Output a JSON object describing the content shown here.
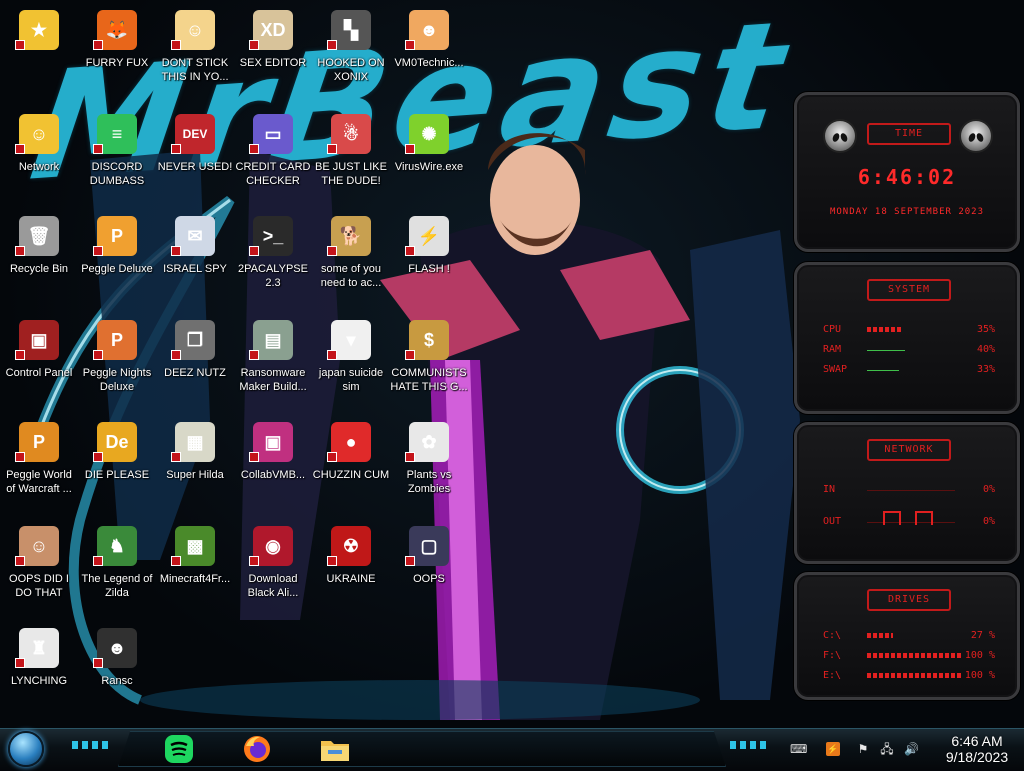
{
  "desktop": {
    "wallpaper_text": "MrBeast",
    "icons": [
      {
        "label": "",
        "color": "#f1c232",
        "glyph": "★"
      },
      {
        "label": "FURRY FUX",
        "color": "#e8661a",
        "glyph": "🦊"
      },
      {
        "label": "DONT STICK THIS IN YO...",
        "color": "#f4d48c",
        "glyph": "☺"
      },
      {
        "label": "SEX EDITOR",
        "color": "#d8c39a",
        "glyph": "XD"
      },
      {
        "label": "HOOKED ON XONIX",
        "color": "#555555",
        "glyph": "▚"
      },
      {
        "label": "VM0Technic...",
        "color": "#f0a860",
        "glyph": "☻"
      },
      {
        "label": "Network",
        "color": "#f1c232",
        "glyph": "☺"
      },
      {
        "label": "DISCORD DUMBASS",
        "color": "#2fbf5a",
        "glyph": "≡"
      },
      {
        "label": "NEVER USED!",
        "color": "#c0262c",
        "glyph": "DEV"
      },
      {
        "label": "CREDIT CARD CHECKER",
        "color": "#6a5acd",
        "glyph": "▭"
      },
      {
        "label": "BE JUST LIKE THE DUDE!",
        "color": "#d94a4a",
        "glyph": "☃"
      },
      {
        "label": "VirusWire.exe",
        "color": "#7fd12c",
        "glyph": "✺"
      },
      {
        "label": "Recycle Bin",
        "color": "#9a9a9a",
        "glyph": "🗑"
      },
      {
        "label": "Peggle Deluxe",
        "color": "#f0a030",
        "glyph": "P"
      },
      {
        "label": "ISRAEL SPY",
        "color": "#cfd8e6",
        "glyph": "✉"
      },
      {
        "label": "2PACALYPSE 2.3",
        "color": "#2a2a2a",
        "glyph": ">_"
      },
      {
        "label": "some of you need to ac...",
        "color": "#c8a050",
        "glyph": "🐕"
      },
      {
        "label": "FLASH !",
        "color": "#e0e0e0",
        "glyph": "⚡"
      },
      {
        "label": "Control Panel",
        "color": "#a02020",
        "glyph": "▣"
      },
      {
        "label": "Peggle Nights Deluxe",
        "color": "#e07030",
        "glyph": "P"
      },
      {
        "label": "DEEZ NUTZ",
        "color": "#707070",
        "glyph": "❐"
      },
      {
        "label": "Ransomware Maker Build...",
        "color": "#8aa090",
        "glyph": "▤"
      },
      {
        "label": "japan suicide sim",
        "color": "#f0f0f0",
        "glyph": "▾"
      },
      {
        "label": "COMMUNISTS HATE THIS G...",
        "color": "#c89a40",
        "glyph": "$"
      },
      {
        "label": "Peggle World of Warcraft ...",
        "color": "#e08a20",
        "glyph": "P"
      },
      {
        "label": "DIE PLEASE",
        "color": "#e8a820",
        "glyph": "De"
      },
      {
        "label": "Super Hilda",
        "color": "#d8d8c8",
        "glyph": "▦"
      },
      {
        "label": "CollabVMB...",
        "color": "#c03080",
        "glyph": "▣"
      },
      {
        "label": "CHUZZIN CUM",
        "color": "#e02a2a",
        "glyph": "●"
      },
      {
        "label": "Plants vs Zombies",
        "color": "#e8e8e8",
        "glyph": "✿"
      },
      {
        "label": "OOPS DID I DO THAT",
        "color": "#c8906a",
        "glyph": "☺"
      },
      {
        "label": "The Legend of Zilda",
        "color": "#3a8a3a",
        "glyph": "♞"
      },
      {
        "label": "Minecraft4Fr...",
        "color": "#4a8a2a",
        "glyph": "▩"
      },
      {
        "label": "Download Black Ali...",
        "color": "#b0182c",
        "glyph": "◉"
      },
      {
        "label": "UKRAINE",
        "color": "#c01818",
        "glyph": "☢"
      },
      {
        "label": "OOPS",
        "color": "#3a3a5a",
        "glyph": "▢"
      },
      {
        "label": "LYNCHING",
        "color": "#e8e8e8",
        "glyph": "♜"
      },
      {
        "label": "Ransc",
        "color": "#303030",
        "glyph": "☻"
      }
    ]
  },
  "gadgets": {
    "time": {
      "title": "Time",
      "clock": "6:46:02",
      "date": "monday 18 september 2023"
    },
    "system": {
      "title": "System",
      "rows": [
        {
          "name": "CPU",
          "value": "35%",
          "level": 0.35
        },
        {
          "name": "RAM",
          "value": "40%",
          "level": 0.4
        },
        {
          "name": "SWAP",
          "value": "33%",
          "level": 0.33
        }
      ]
    },
    "network": {
      "title": "Network",
      "rows": [
        {
          "name": "IN",
          "value": "0%"
        },
        {
          "name": "OUT",
          "value": "0%"
        }
      ]
    },
    "drives": {
      "title": "Drives",
      "rows": [
        {
          "name": "C:\\",
          "value": "27 %",
          "level": 0.27
        },
        {
          "name": "F:\\",
          "value": "100 %",
          "level": 1.0
        },
        {
          "name": "E:\\",
          "value": "100 %",
          "level": 1.0
        }
      ]
    }
  },
  "taskbar": {
    "apps": [
      {
        "name": "spotify",
        "color": "#1ed760"
      },
      {
        "name": "firefox",
        "color": "#ff7a1a"
      },
      {
        "name": "file-explorer",
        "color": "#f2c14e"
      }
    ],
    "clock_time": "6:46 AM",
    "clock_date": "9/18/2023"
  },
  "colors": {
    "accent_red": "#e02020",
    "accent_cyan": "#2ec3e6"
  }
}
